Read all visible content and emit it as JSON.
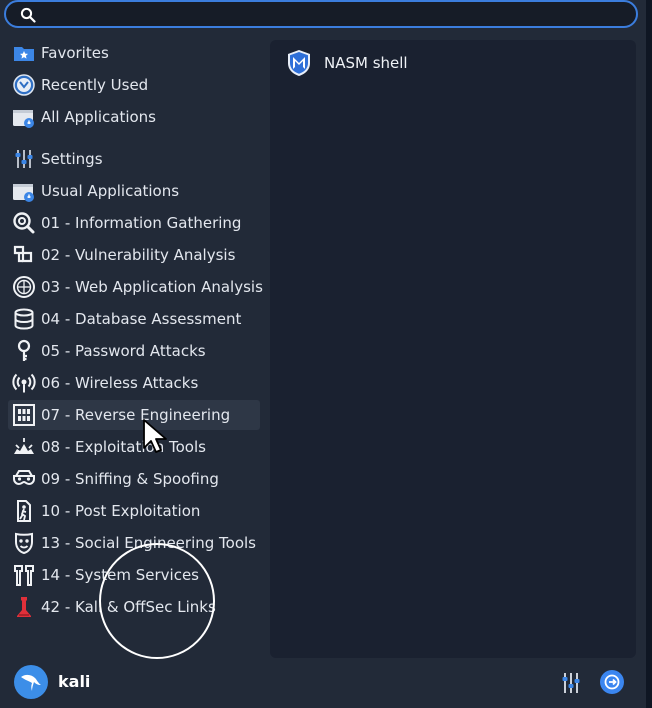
{
  "search": {
    "value": "",
    "placeholder": ""
  },
  "categories": [
    {
      "label": "Favorites",
      "icon": "favorites-folder-icon"
    },
    {
      "label": "Recently Used",
      "icon": "recently-used-icon"
    },
    {
      "label": "All Applications",
      "icon": "all-applications-icon"
    },
    {
      "label": "Settings",
      "icon": "settings-sliders-icon"
    },
    {
      "label": "Usual Applications",
      "icon": "usual-applications-icon"
    },
    {
      "label": "01 - Information Gathering",
      "icon": "information-gathering-icon"
    },
    {
      "label": "02 - Vulnerability Analysis",
      "icon": "vulnerability-analysis-icon"
    },
    {
      "label": "03 - Web Application Analysis",
      "icon": "web-application-icon"
    },
    {
      "label": "04 - Database Assessment",
      "icon": "database-icon"
    },
    {
      "label": "05 - Password Attacks",
      "icon": "password-key-icon"
    },
    {
      "label": "06 - Wireless Attacks",
      "icon": "wireless-icon"
    },
    {
      "label": "07 - Reverse Engineering",
      "icon": "reverse-engineering-icon"
    },
    {
      "label": "08 - Exploitation Tools",
      "icon": "exploitation-tools-icon"
    },
    {
      "label": "09 - Sniffing & Spoofing",
      "icon": "sniffing-spoofing-icon"
    },
    {
      "label": "10 - Post Exploitation",
      "icon": "post-exploitation-icon"
    },
    {
      "label": "13 - Social Engineering Tools",
      "icon": "social-engineering-icon"
    },
    {
      "label": "14 - System Services",
      "icon": "system-services-icon"
    },
    {
      "label": "42 - Kali & OffSec Links",
      "icon": "kali-offsec-icon"
    }
  ],
  "selected_category": "07 - Reverse Engineering",
  "apps": [
    {
      "label": "NASM shell",
      "icon": "metasploit-shield-icon"
    }
  ],
  "footer": {
    "user_name": "kali"
  },
  "colors": {
    "accent": "#3b7ddd",
    "menu_bg": "#222a38",
    "panel_bg": "#1a2130",
    "selected_bg": "#2e3746"
  }
}
